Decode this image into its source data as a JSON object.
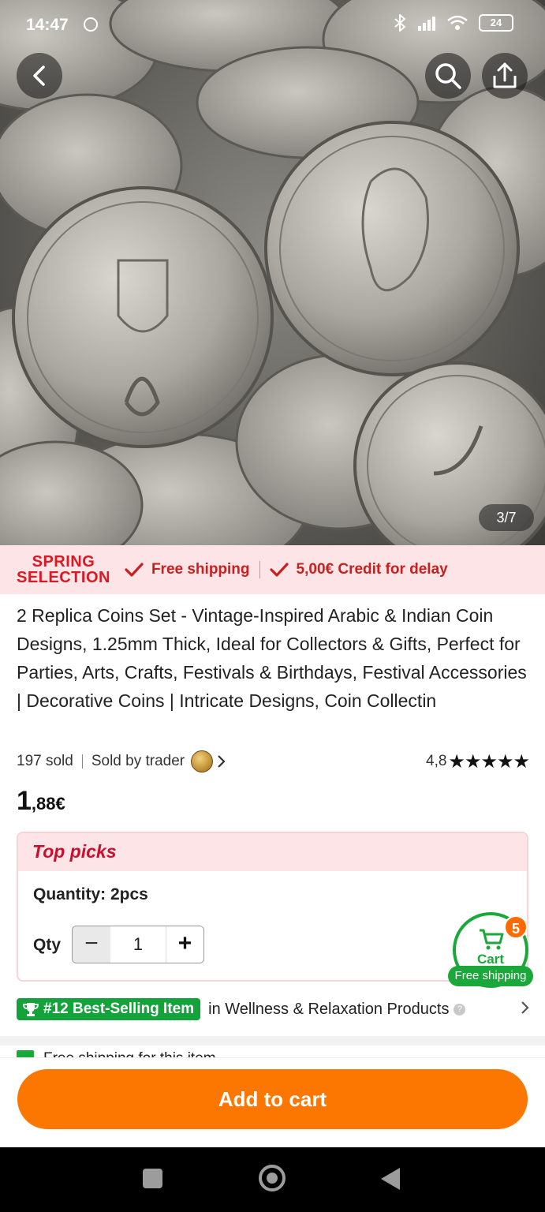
{
  "status_bar": {
    "time": "14:47",
    "battery": "24"
  },
  "gallery": {
    "counter": "3/7"
  },
  "promo": {
    "brand_line1": "SPRING",
    "brand_line2": "SELECTION",
    "free_shipping": "Free shipping",
    "credit": "5,00€ Credit for delay"
  },
  "product": {
    "title": "2 Replica Coins Set - Vintage-Inspired Arabic & Indian Coin Designs, 1.25mm Thick, Ideal for Collectors & Gifts, Perfect for Parties, Arts, Crafts, Festivals & Birthdays, Festival Accessories | Decorative Coins | Intricate Designs, Coin Collectin",
    "sold": "197 sold",
    "seller": "Sold by trader",
    "rating": "4,8",
    "stars": "★★★★★",
    "price_whole": "1",
    "price_frac": ",88€"
  },
  "options": {
    "header": "Top picks",
    "quantity_label": "Quantity: 2pcs",
    "qty_label": "Qty",
    "qty_value": "1",
    "minus": "−",
    "plus": "+"
  },
  "cart": {
    "count": "5",
    "label": "Cart",
    "free_shipping": "Free shipping"
  },
  "best_selling": {
    "badge": "#12 Best-Selling Item",
    "category": "in Wellness & Relaxation Products",
    "help": "?"
  },
  "peek_text": "Free shipping for this item",
  "add_to_cart": "Add to cart",
  "colors": {
    "accent": "#fb7701",
    "green": "#1aa83a",
    "red": "#d91a24",
    "promo_bg": "#fde4e6"
  },
  "icons": [
    "back-icon",
    "search-icon",
    "share-icon",
    "checkmark-icon",
    "chevron-right-icon",
    "star-icon",
    "trophy-icon",
    "cart-icon"
  ]
}
